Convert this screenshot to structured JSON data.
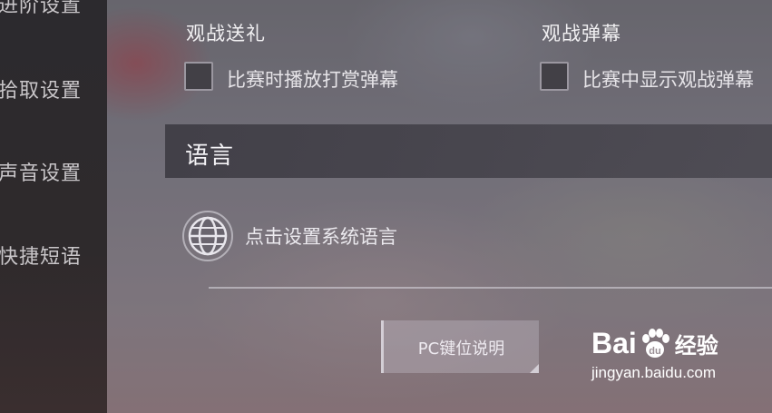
{
  "sidebar": {
    "items": [
      {
        "label": "进阶设置"
      },
      {
        "label": "拾取设置"
      },
      {
        "label": "声音设置"
      },
      {
        "label": "快捷短语"
      }
    ]
  },
  "spectate_gift": {
    "title": "观战送礼",
    "checkbox_label": "比赛时播放打赏弹幕",
    "checked": false
  },
  "spectate_danmaku": {
    "title": "观战弹幕",
    "checkbox_label": "比赛中显示观战弹幕",
    "checked": false
  },
  "language": {
    "section_title": "语言",
    "button_label": "点击设置系统语言",
    "icon": "globe-icon"
  },
  "pc_keys_button": {
    "label": "PC键位说明"
  },
  "watermark": {
    "brand_left": "Bai",
    "brand_right": "经验",
    "url": "jingyan.baidu.com"
  }
}
